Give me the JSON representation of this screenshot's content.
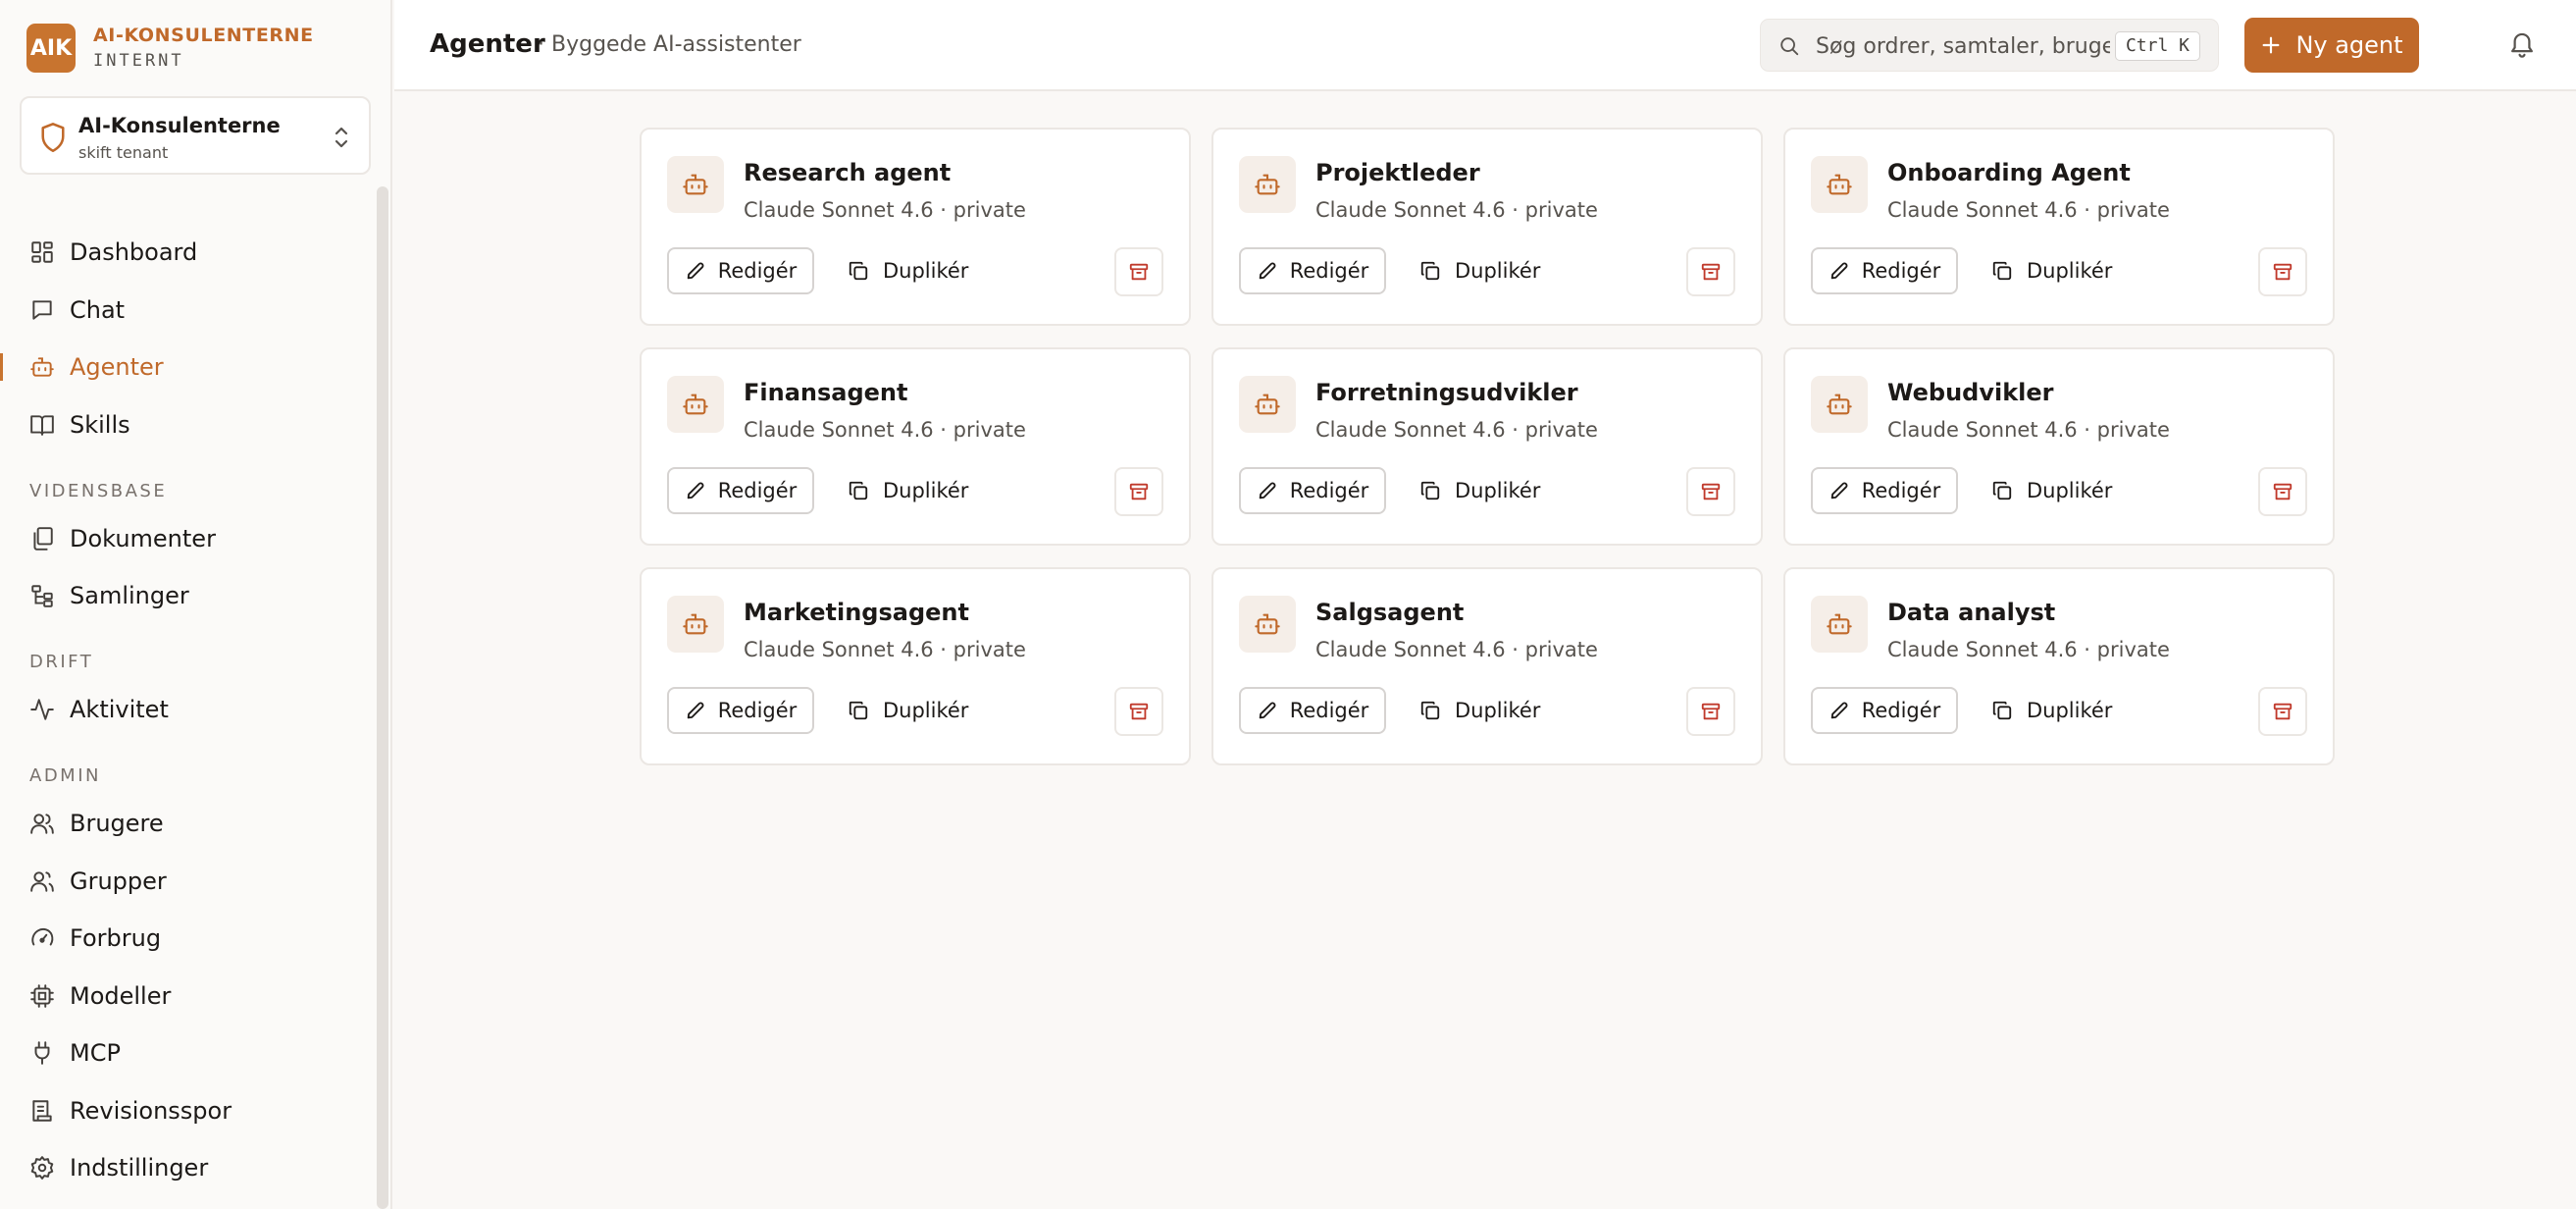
{
  "brand": {
    "logo": "AIK",
    "name": "AI-KONSULENTERNE",
    "sub": "INTERNT"
  },
  "tenant": {
    "name": "AI-Konsulenterne",
    "sub": "skift tenant"
  },
  "nav": {
    "main": [
      {
        "label": "Dashboard",
        "icon": "dashboard-icon"
      },
      {
        "label": "Chat",
        "icon": "chat-icon"
      },
      {
        "label": "Agenter",
        "icon": "bot-icon",
        "active": true
      },
      {
        "label": "Skills",
        "icon": "book-icon"
      }
    ],
    "sections": [
      {
        "label": "VIDENSBASE",
        "items": [
          {
            "label": "Dokumenter"
          },
          {
            "label": "Samlinger"
          }
        ]
      },
      {
        "label": "DRIFT",
        "items": [
          {
            "label": "Aktivitet"
          }
        ]
      },
      {
        "label": "ADMIN",
        "items": [
          {
            "label": "Brugere"
          },
          {
            "label": "Grupper"
          },
          {
            "label": "Forbrug"
          },
          {
            "label": "Modeller"
          },
          {
            "label": "MCP"
          },
          {
            "label": "Revisionsspor"
          },
          {
            "label": "Indstillinger"
          }
        ]
      }
    ]
  },
  "header": {
    "title": "Agenter",
    "subtitle": "· Byggede AI-assistenter",
    "search_placeholder": "Søg ordrer, samtaler, bruger...",
    "shortcut": "Ctrl K",
    "new_button": "Ny agent"
  },
  "actions": {
    "edit": "Redigér",
    "duplicate": "Duplikér"
  },
  "agents": [
    {
      "name": "Research agent",
      "meta": "Claude Sonnet 4.6 · private"
    },
    {
      "name": "Projektleder",
      "meta": "Claude Sonnet 4.6 · private"
    },
    {
      "name": "Onboarding Agent",
      "meta": "Claude Sonnet 4.6 · private"
    },
    {
      "name": "Finansagent",
      "meta": "Claude Sonnet 4.6 · private"
    },
    {
      "name": "Forretningsudvikler",
      "meta": "Claude Sonnet 4.6 · private"
    },
    {
      "name": "Webudvikler",
      "meta": "Claude Sonnet 4.6 · private"
    },
    {
      "name": "Marketingsagent",
      "meta": "Claude Sonnet 4.6 · private"
    },
    {
      "name": "Salgsagent",
      "meta": "Claude Sonnet 4.6 · private"
    },
    {
      "name": "Data analyst",
      "meta": "Claude Sonnet 4.6 · private"
    }
  ],
  "colors": {
    "accent": "#c0692a",
    "danger": "#c0392b",
    "text": "#1c1917",
    "muted": "#57534e"
  }
}
